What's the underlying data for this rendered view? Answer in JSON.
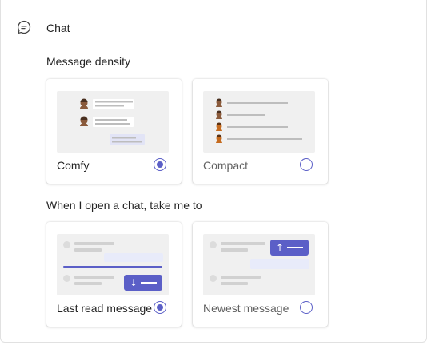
{
  "header": {
    "title": "Chat",
    "icon": "chat-bubble-icon"
  },
  "density": {
    "label": "Message density",
    "options": [
      {
        "label": "Comfy",
        "selected": true
      },
      {
        "label": "Compact",
        "selected": false
      }
    ]
  },
  "open_chat": {
    "label": "When I open a chat, take me to",
    "options": [
      {
        "label": "Last read message",
        "selected": true
      },
      {
        "label": "Newest message",
        "selected": false
      }
    ]
  },
  "colors": {
    "accent": "#5b5fc7",
    "avatar_skin": "#8a5a3b",
    "avatar_hair": "#4a3020"
  }
}
